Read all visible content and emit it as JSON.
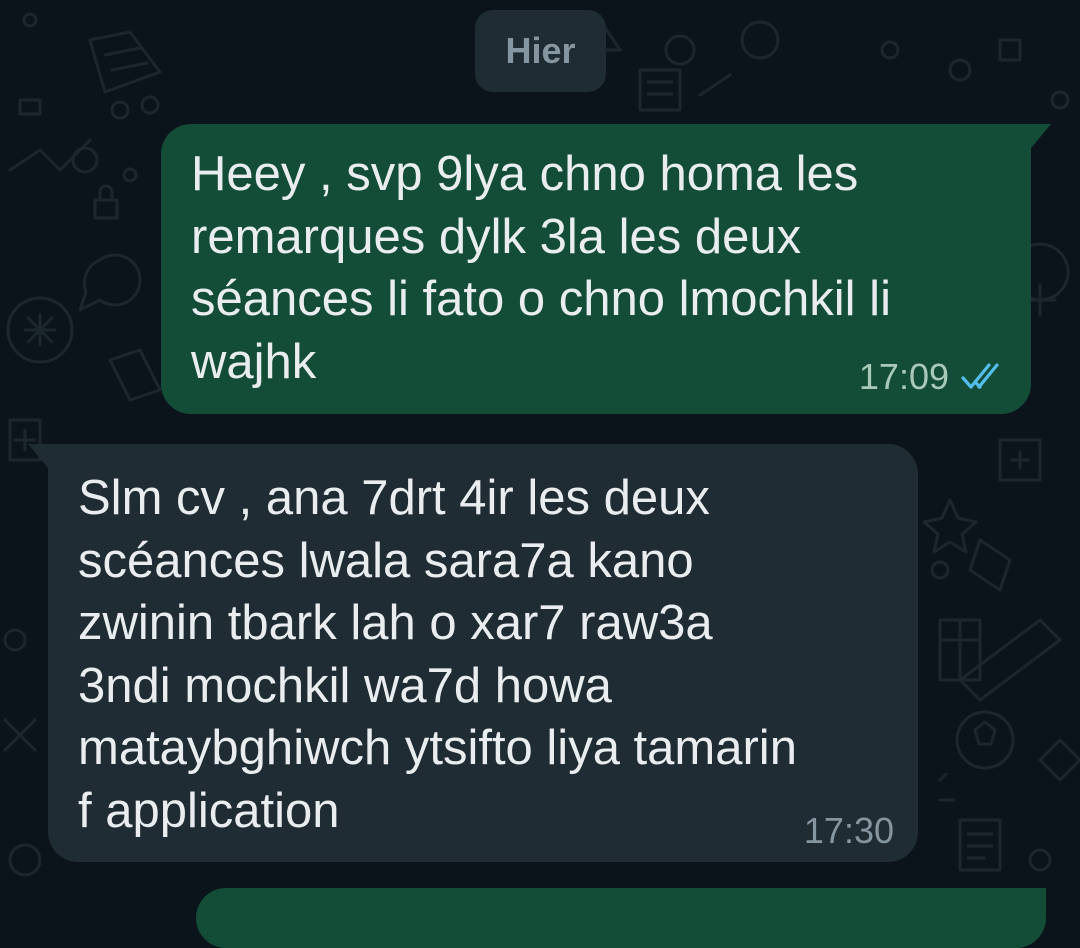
{
  "date_separator": "Hier",
  "messages": [
    {
      "direction": "outgoing",
      "text": "Heey , svp 9lya chno homa les\nremarques dylk 3la les deux\nséances li fato o chno lmochkil li\nwajhk",
      "time": "17:09",
      "status_icon": "double-check-read-icon"
    },
    {
      "direction": "incoming",
      "text": "Slm cv ,  ana 7drt 4ir les deux\nscéances lwala sara7a kano\nzwinin tbark lah o xar7 raw3a\n3ndi mochkil wa7d howa\nmataybghiwch ytsifto liya tamarin\nf application",
      "time": "17:30"
    }
  ],
  "colors": {
    "background": "#0b141a",
    "outgoing_bubble": "#144d37",
    "incoming_bubble": "#202c33",
    "read_tick": "#53bdeb",
    "date_chip": "#1f2c33"
  }
}
